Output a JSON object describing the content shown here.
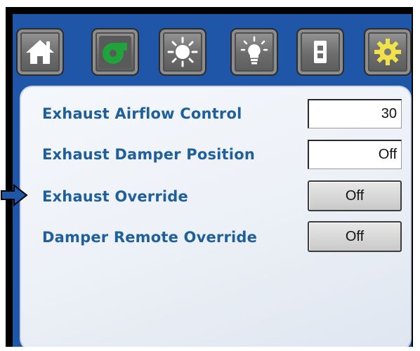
{
  "nav": {
    "tabs": [
      {
        "icon": "home-icon",
        "active": false
      },
      {
        "icon": "fan-icon",
        "active": true,
        "color": "#1fa33a"
      },
      {
        "icon": "sun-icon",
        "active": false
      },
      {
        "icon": "light-bulb-icon",
        "active": false
      },
      {
        "icon": "switch-panel-icon",
        "active": false
      },
      {
        "icon": "settings-gear-icon",
        "active": false,
        "color": "#f2e24a"
      }
    ]
  },
  "settings": {
    "rows": [
      {
        "label": "Exhaust Airflow Control",
        "value": "30",
        "kind": "input"
      },
      {
        "label": "Exhaust Damper Position",
        "value": "Off",
        "kind": "input"
      },
      {
        "label": "Exhaust Override",
        "value": "Off",
        "kind": "button",
        "selected": true
      },
      {
        "label": "Damper Remote Override",
        "value": "Off",
        "kind": "button"
      }
    ]
  },
  "colors": {
    "screen_background": "#1f56a8",
    "label_text": "#1f5f9a",
    "selection_arrow": "#1f56a8"
  }
}
